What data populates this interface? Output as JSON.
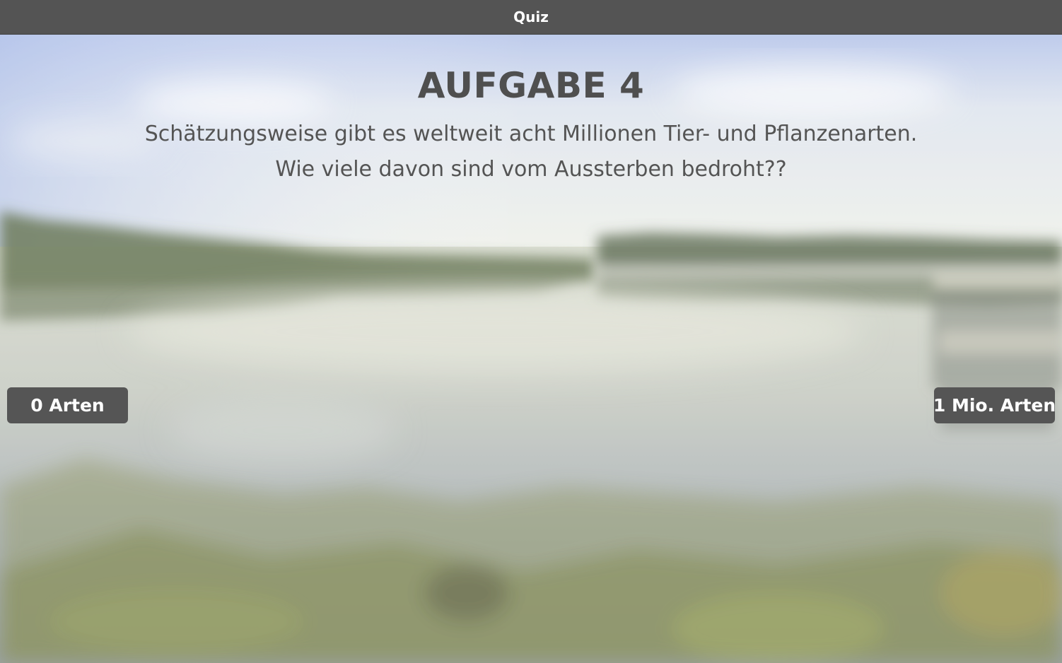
{
  "window": {
    "title": "Quiz"
  },
  "task": {
    "heading": "AUFGABE 4",
    "question_line1": "Schätzungsweise gibt es weltweit acht Millionen Tier- und Pflanzenarten.",
    "question_line2": "Wie viele davon sind vom Aussterben bedroht??"
  },
  "answers": {
    "min_label": "0 Arten",
    "max_label": "1 Mio. Arten"
  },
  "background": {
    "subject": "blurred-lake-landscape",
    "colors": {
      "sky": "#c5d1ec",
      "water": "#c9ccc0",
      "trees": "#5d6a4c",
      "reeds": "#7f8a52"
    }
  },
  "colors": {
    "titlebar": "#545454",
    "button": "#555555",
    "text": "#4f4f4f"
  }
}
